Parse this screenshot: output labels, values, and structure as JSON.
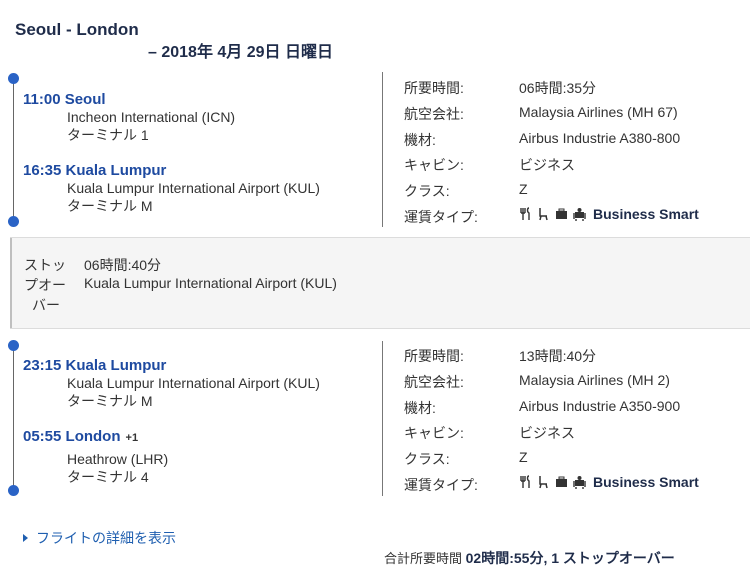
{
  "header": {
    "route": "Seoul - London",
    "date": "– 2018年 4月 29日 日曜日"
  },
  "segments": [
    {
      "departure": {
        "time_city": "11:00 Seoul",
        "airport": "Incheon International (ICN)",
        "terminal": "ターミナル 1"
      },
      "arrival": {
        "time_city": "16:35 Kuala Lumpur",
        "day_offset": "",
        "airport": "Kuala Lumpur International Airport (KUL)",
        "terminal": "ターミナル M"
      },
      "details": {
        "duration_label": "所要時間:",
        "duration": "06時間:35分",
        "airline_label": "航空会社:",
        "airline": "Malaysia Airlines (MH 67)",
        "aircraft_label": "機材:",
        "aircraft": "Airbus Industrie A380-800",
        "cabin_label": "キャビン:",
        "cabin": "ビジネス",
        "class_label": "クラス:",
        "class": "Z",
        "fare_label": "運賃タイプ:",
        "fare": "Business Smart"
      }
    },
    {
      "departure": {
        "time_city": "23:15 Kuala Lumpur",
        "airport": "Kuala Lumpur International Airport (KUL)",
        "terminal": "ターミナル M"
      },
      "arrival": {
        "time_city": "05:55 London",
        "day_offset": "+1",
        "airport": "Heathrow (LHR)",
        "terminal": "ターミナル 4"
      },
      "details": {
        "duration_label": "所要時間:",
        "duration": "13時間:40分",
        "airline_label": "航空会社:",
        "airline": "Malaysia Airlines (MH 2)",
        "aircraft_label": "機材:",
        "aircraft": "Airbus Industrie A350-900",
        "cabin_label": "キャビン:",
        "cabin": "ビジネス",
        "class_label": "クラス:",
        "class": "Z",
        "fare_label": "運賃タイプ:",
        "fare": "Business Smart"
      }
    }
  ],
  "stopover": {
    "label_line1": "ストッ",
    "label_line2": "プオー",
    "label_line3": "バー",
    "duration": "06時間:40分",
    "airport": "Kuala Lumpur International Airport (KUL)"
  },
  "footer": {
    "details_link": "フライトの詳細を表示",
    "total_label": "合計所要時間",
    "total_value": "02時間:55分, 1 ストップオーバー"
  },
  "icons": [
    "fork-knife-icon",
    "seat-icon",
    "baggage-icon",
    "lounge-icon",
    "chevron-right-icon"
  ],
  "colors": {
    "accent": "#1e4aa0",
    "dot": "#2a63c6",
    "title": "#1f2c4a"
  }
}
